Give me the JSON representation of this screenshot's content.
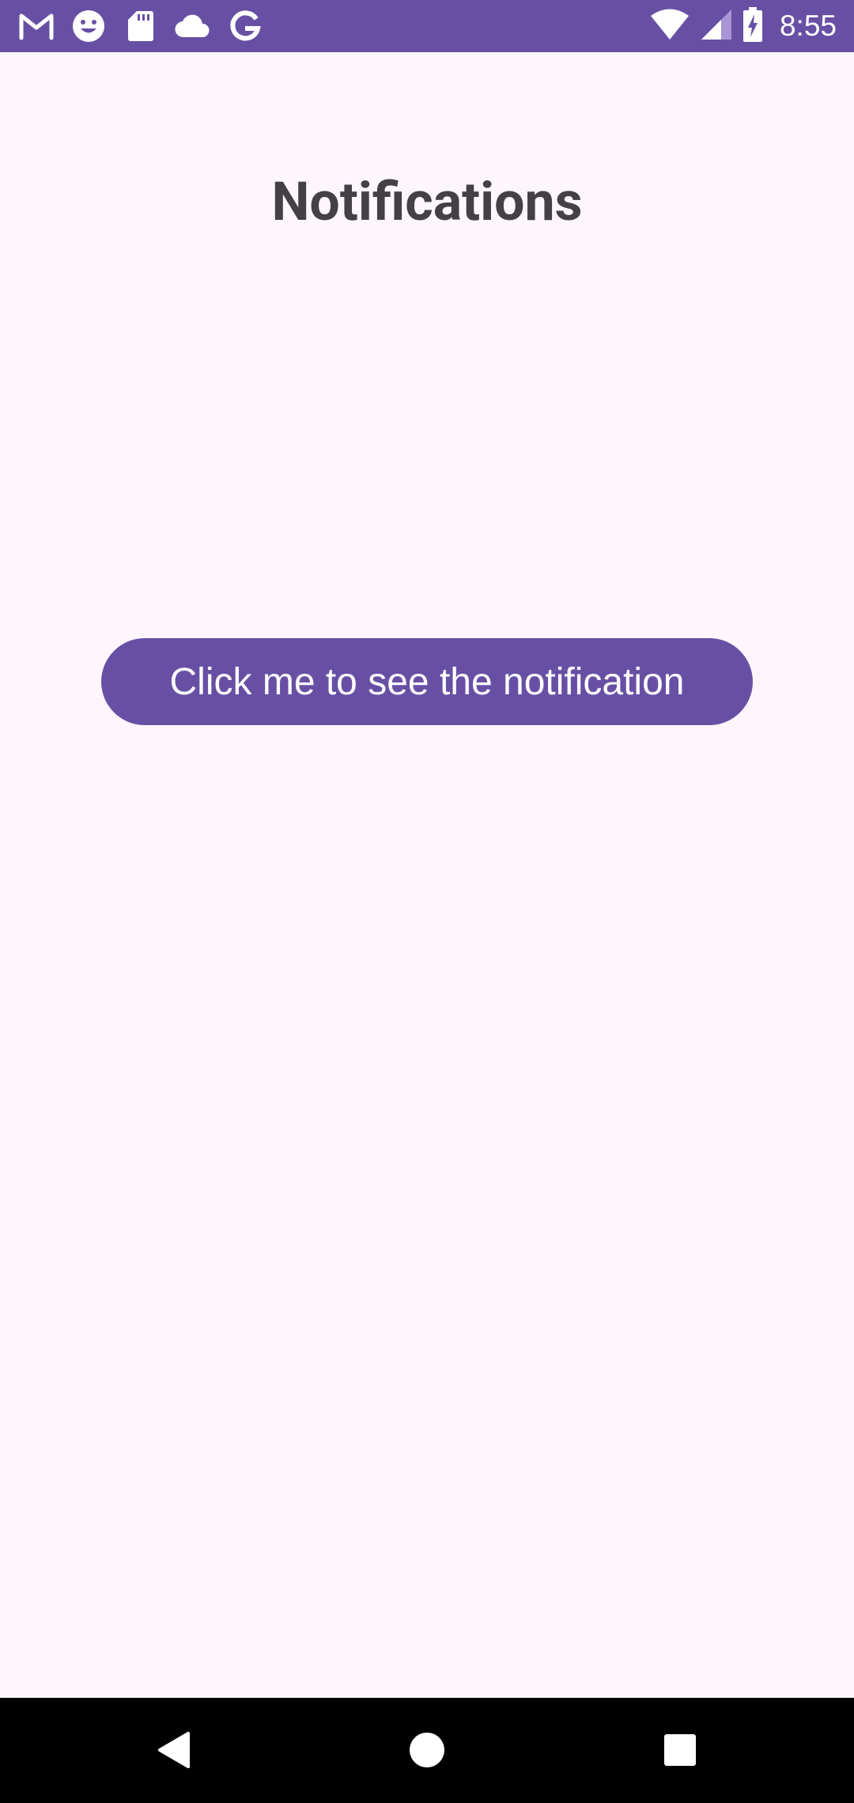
{
  "status_bar": {
    "time": "8:55",
    "notification_icons": [
      "gmail-icon",
      "smiley-icon",
      "sd-card-icon",
      "cloud-icon",
      "google-icon"
    ],
    "system_icons": [
      "wifi-icon",
      "cell-signal-icon",
      "battery-charging-icon"
    ],
    "background_color": "#6750A4"
  },
  "main": {
    "title": "Notifications",
    "button_label": "Click me to see the notification",
    "accent_color": "#6750A4",
    "background_color": "#FDF7FD"
  },
  "nav_bar": {
    "buttons": [
      "back-icon",
      "home-icon",
      "recents-icon"
    ]
  }
}
